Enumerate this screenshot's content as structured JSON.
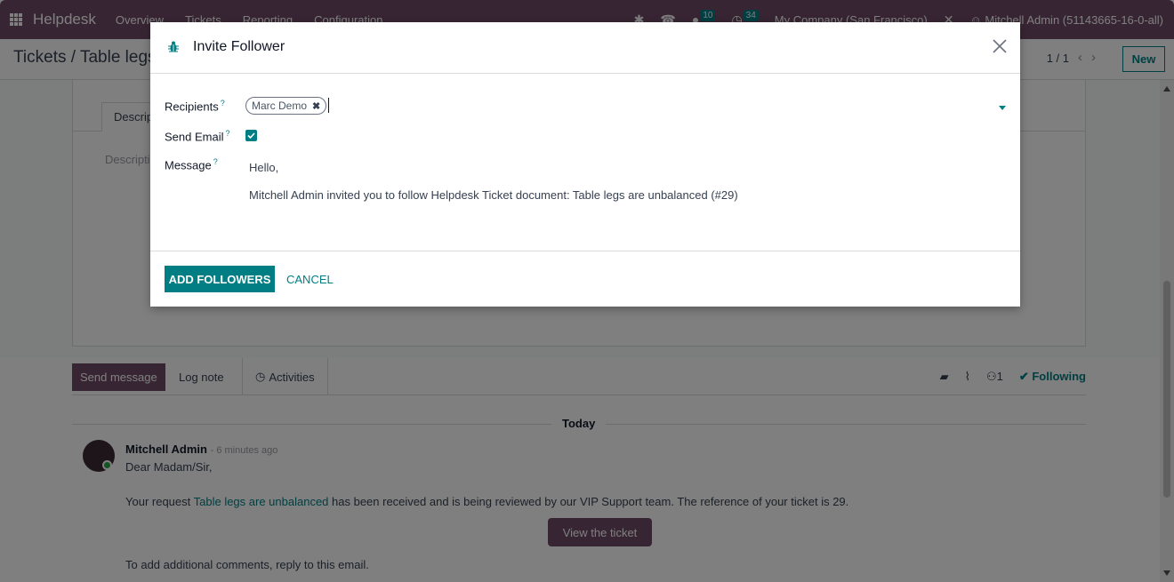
{
  "navbar": {
    "brand": "Helpdesk",
    "menu": [
      "Overview",
      "Tickets",
      "Reporting",
      "Configuration"
    ],
    "messages_count": "10",
    "activities_count": "34",
    "company": "My Company (San Francisco)",
    "user": "Mitchell Admin (51143665-16-0-all)"
  },
  "control_panel": {
    "breadcrumb": "Tickets / Table legs are unbalanced",
    "pager": "1 / 1",
    "new_label": "New"
  },
  "form": {
    "tab_description": "Description",
    "description_placeholder": "Description of the ticket..."
  },
  "chatter": {
    "send_message": "Send message",
    "log_note": "Log note",
    "activities": "Activities",
    "followers_count": "1",
    "following": "Following",
    "date_separator": "Today",
    "message": {
      "author": "Mitchell Admin",
      "time": "- 6 minutes ago",
      "greeting": "Dear Madam/Sir,",
      "body_prefix": "Your request ",
      "body_link": "Table legs are unbalanced",
      "body_suffix": " has been received and is being reviewed by our VIP Support team. The reference of your ticket is 29.",
      "button": "View the ticket",
      "footer": "To add additional comments, reply to this email."
    }
  },
  "modal": {
    "title": "Invite Follower",
    "fields": {
      "recipients_label": "Recipients",
      "send_email_label": "Send Email",
      "message_label": "Message",
      "help_mark": "?"
    },
    "recipients": [
      "Marc Demo"
    ],
    "send_email": true,
    "message_lines": [
      "Hello,",
      "Mitchell Admin invited you to follow Helpdesk Ticket document: Table legs are unbalanced (#29)"
    ],
    "add_followers": "ADD FOLLOWERS",
    "cancel": "CANCEL"
  },
  "colors": {
    "brand": "#714b67",
    "accent": "#017e84"
  }
}
